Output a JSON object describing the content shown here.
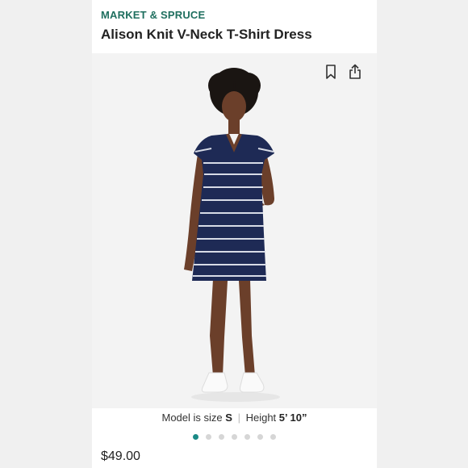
{
  "listing": {
    "brand": "MARKET & SPRUCE",
    "title": "Alison Knit V-Neck T-Shirt Dress",
    "price": "$49.00"
  },
  "photo": {
    "description_icons": [
      "bookmark-icon",
      "share-icon"
    ],
    "carousel": {
      "total": 7,
      "active_index": 0
    }
  },
  "model_info": {
    "prefix": "Model is size",
    "size": "S",
    "separator": "|",
    "height_label": "Height",
    "height_value": "5’ 10”"
  },
  "colors": {
    "brand": "#1f6f5f",
    "dot_active": "#1a8a86",
    "dot_inactive": "#d6d6d6",
    "dress_navy": "#1e2a55"
  }
}
